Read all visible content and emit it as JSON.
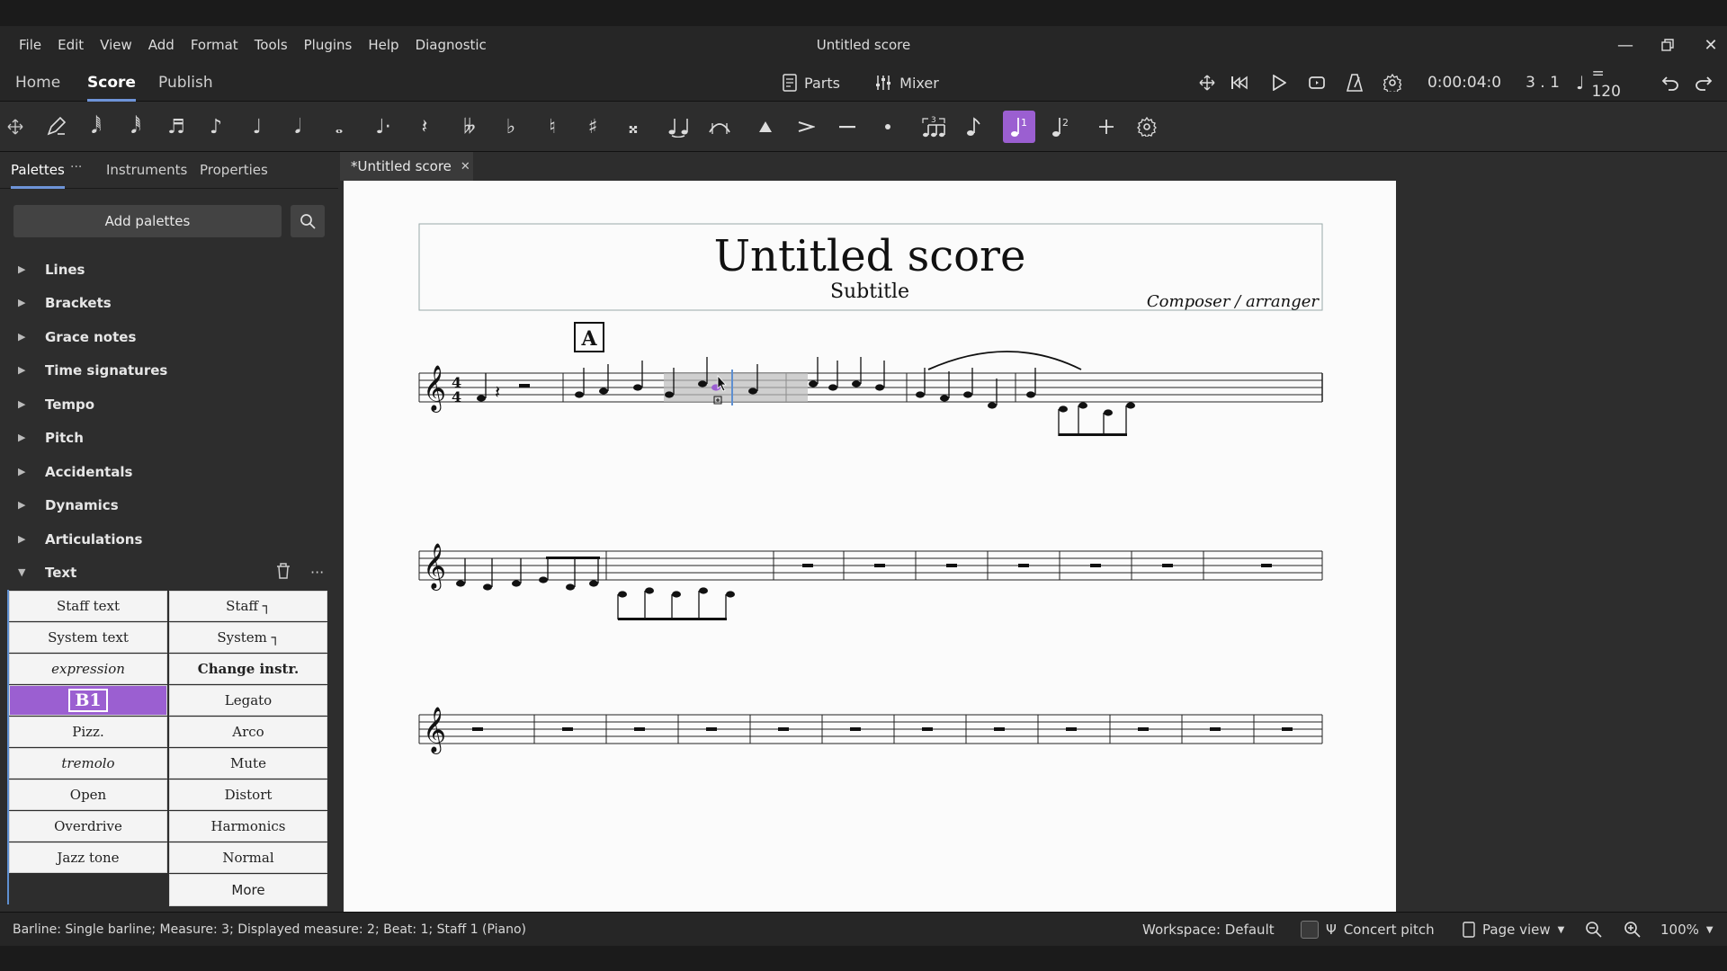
{
  "menu": [
    "File",
    "Edit",
    "View",
    "Add",
    "Format",
    "Tools",
    "Plugins",
    "Help",
    "Diagnostic"
  ],
  "window_title": "Untitled score",
  "modes": {
    "home": "Home",
    "score": "Score",
    "publish": "Publish"
  },
  "toolbar": {
    "parts": "Parts",
    "mixer": "Mixer",
    "time": "0:00:04:0",
    "position": "3 . 1",
    "tempo": "= 120"
  },
  "panel_tabs": {
    "palettes": "Palettes",
    "instruments": "Instruments",
    "properties": "Properties"
  },
  "add_palettes": "Add palettes",
  "palettes": [
    "Lines",
    "Brackets",
    "Grace notes",
    "Time signatures",
    "Tempo",
    "Pitch",
    "Accidentals",
    "Dynamics",
    "Articulations"
  ],
  "text_palette": "Text",
  "text_items": [
    [
      "Staff text",
      "Staff ┐"
    ],
    [
      "System text",
      "System ┐"
    ],
    [
      "expression",
      "Change instr."
    ],
    [
      "B1",
      "Legato"
    ],
    [
      "Pizz.",
      "Arco"
    ],
    [
      "tremolo",
      "Mute"
    ],
    [
      "Open",
      "Distort"
    ],
    [
      "Overdrive",
      "Harmonics"
    ],
    [
      "Jazz tone",
      "Normal"
    ],
    [
      "",
      "More"
    ]
  ],
  "doc_tab": "*Untitled score",
  "score": {
    "title": "Untitled score",
    "subtitle": "Subtitle",
    "composer": "Composer / arranger",
    "rehearsal_mark": "A"
  },
  "status": "Barline: Single barline; Measure: 3; Displayed measure: 2; Beat: 1; Staff 1 (Piano)",
  "statusbar": {
    "workspace": "Workspace: Default",
    "concert_pitch": "Concert pitch",
    "page_view": "Page view",
    "zoom": "100%"
  },
  "colors": {
    "accent": "#9b5fd1",
    "tab_underline": "#6e94d8",
    "selection": "#5e8fd0"
  }
}
